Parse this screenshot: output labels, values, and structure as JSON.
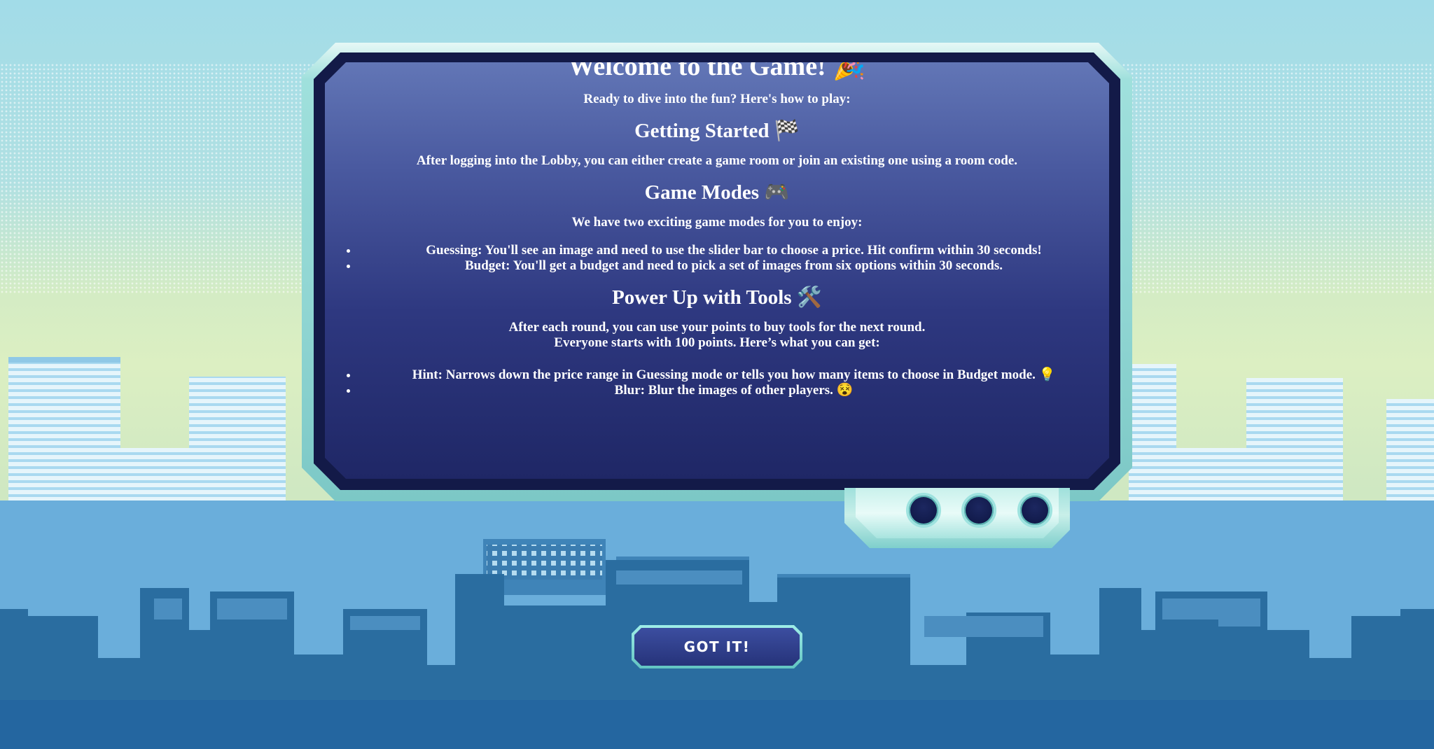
{
  "modal": {
    "title": "Welcome to the Game! 🎉",
    "intro": "Ready to dive into the fun? Here's how to play:",
    "sections": [
      {
        "heading": "Getting Started 🏁",
        "text": "After logging into the Lobby, you can either create a game room or join an existing one using a room code."
      },
      {
        "heading": "Game Modes 🎮",
        "text": "We have two exciting game modes for you to enjoy:",
        "items": [
          "Guessing: You'll see an image and need to use the slider bar to choose a price. Hit confirm within 30 seconds!",
          "Budget: You'll get a budget and need to pick a set of images from six options within 30 seconds."
        ]
      },
      {
        "heading": "Power Up with Tools 🛠️",
        "text_line1": "After each round, you can use your points to buy tools for the next round.",
        "text_line2": "Everyone starts with 100 points. Here’s what you can get:",
        "items": [
          "Hint: Narrows down the price range in Guessing mode or tells you how many items to choose in Budget mode. 💡",
          "Blur: Blur the images of other players. 😵"
        ]
      }
    ]
  },
  "button": {
    "label": "GOT IT!"
  },
  "colors": {
    "sky": "#a2dce8",
    "frame": "#8fd5d2",
    "screen_top": "#6276b6",
    "screen_bottom": "#1f2766",
    "building_light": "#a8d8ee",
    "building_dark": "#2f6fa0"
  }
}
